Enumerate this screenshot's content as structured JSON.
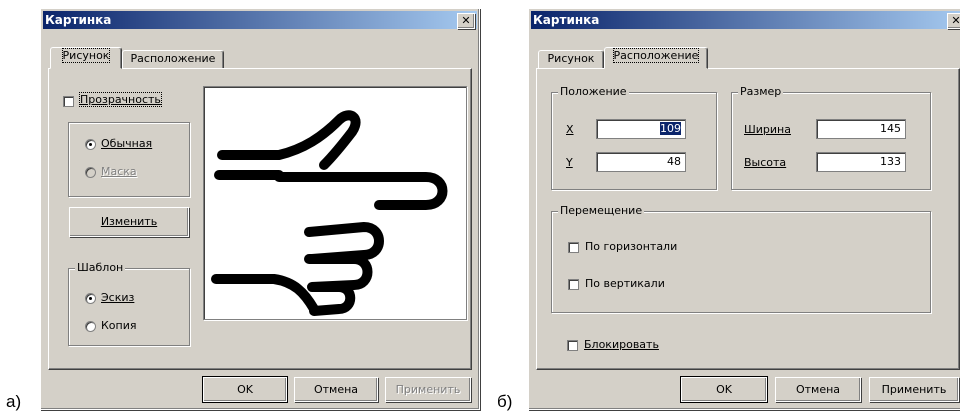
{
  "captions": {
    "a": "а)",
    "b": "б)"
  },
  "dialog_a": {
    "title": "Картинка",
    "tabs": [
      "Рисунок",
      "Расположение"
    ],
    "transparency": {
      "label": "Прозрачность",
      "checked": false
    },
    "mode": {
      "options": [
        {
          "label": "Обычная",
          "checked": true,
          "disabled": false
        },
        {
          "label": "Маска",
          "checked": false,
          "disabled": true
        }
      ]
    },
    "change_button": "Изменить",
    "template_group": {
      "title": "Шаблон",
      "options": [
        {
          "label": "Эскиз",
          "checked": true
        },
        {
          "label": "Копия",
          "checked": false
        }
      ]
    },
    "image_icon": "pointing-hand-icon",
    "buttons": {
      "ok": "OK",
      "cancel": "Отмена",
      "apply": "Применить"
    }
  },
  "dialog_b": {
    "title": "Картинка",
    "tabs": [
      "Рисунок",
      "Расположение"
    ],
    "position_group": {
      "title": "Положение",
      "x_label": "X",
      "x_value": "109",
      "y_label": "Y",
      "y_value": "48"
    },
    "size_group": {
      "title": "Размер",
      "width_label": "Ширина",
      "width_value": "145",
      "height_label": "Высота",
      "height_value": "133"
    },
    "move_group": {
      "title": "Перемещение",
      "horizontal": "По горизонтали",
      "vertical": "По вертикали"
    },
    "lock_label": "Блокировать",
    "buttons": {
      "ok": "OK",
      "cancel": "Отмена",
      "apply": "Применить"
    }
  }
}
